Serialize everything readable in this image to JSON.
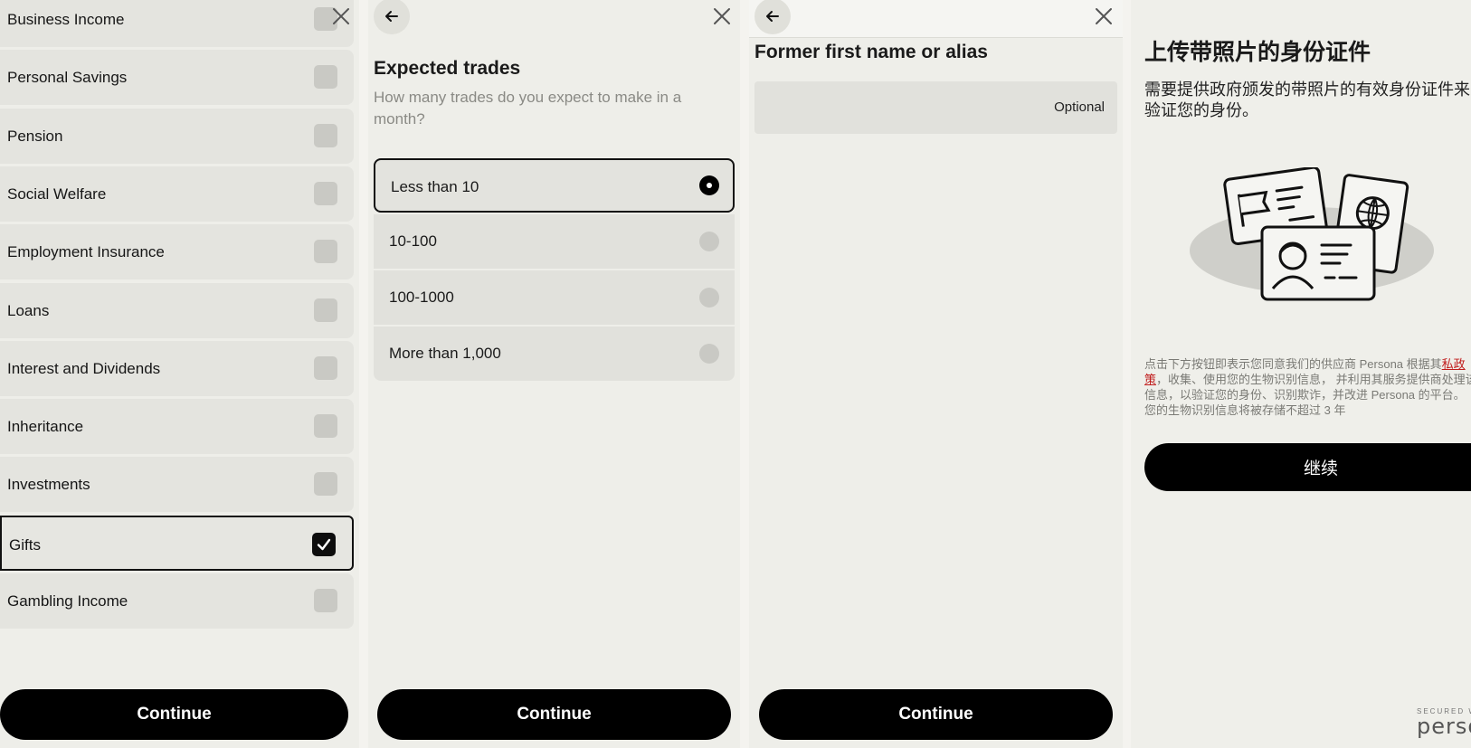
{
  "panel1": {
    "sources": [
      {
        "label": "Business Income",
        "checked": false
      },
      {
        "label": "Personal Savings",
        "checked": false
      },
      {
        "label": "Pension",
        "checked": false
      },
      {
        "label": "Social Welfare",
        "checked": false
      },
      {
        "label": "Employment Insurance",
        "checked": false
      },
      {
        "label": "Loans",
        "checked": false
      },
      {
        "label": "Interest and Dividends",
        "checked": false
      },
      {
        "label": "Inheritance",
        "checked": false
      },
      {
        "label": "Investments",
        "checked": false
      },
      {
        "label": "Gifts",
        "checked": true
      },
      {
        "label": "Gambling Income",
        "checked": false
      }
    ],
    "continue_label": "Continue"
  },
  "panel2": {
    "title": "Expected trades",
    "subtitle": "How many trades do you expect to make in a month?",
    "options": [
      {
        "label": "Less than 10",
        "selected": true
      },
      {
        "label": "10-100",
        "selected": false
      },
      {
        "label": "100-1000",
        "selected": false
      },
      {
        "label": "More than 1,000",
        "selected": false
      }
    ],
    "continue_label": "Continue"
  },
  "panel3": {
    "title": "Former first name or alias",
    "field_placeholder": "Optional",
    "continue_label": "Continue"
  },
  "panel4": {
    "title": "上传带照片的身份证件",
    "description": "需要提供政府颁发的带照片的有效身份证件来验证您的身份。",
    "consent_before": "点击下方按钮即表示您同意我们的供应商 Persona 根据其",
    "consent_link": "私政策",
    "consent_after": "，收集、使用您的生物识别信息， 并利用其服务提供商处理该信息，以验证您的身份、识别欺诈，并改进 Persona 的平台。 您的生物识别信息将被存储不超过 3 年",
    "continue_label": "继续",
    "secured_label": "SECURED W",
    "brand_label": "person"
  },
  "colors": {
    "background": "#eeeee9",
    "button": "#000000",
    "link": "#c01c1c"
  }
}
